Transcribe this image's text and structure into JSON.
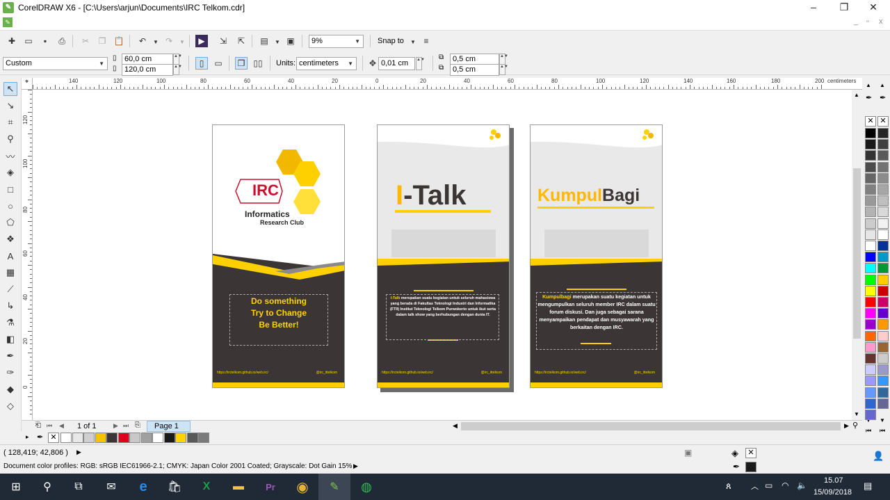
{
  "app": {
    "title": "CorelDRAW X6 - [C:\\Users\\arjun\\Documents\\IRC Telkom.cdr]"
  },
  "window": {
    "minimize": "–",
    "restore": "❐",
    "close": "✕",
    "doc_min": "_",
    "doc_restore": "▫",
    "doc_close": "x"
  },
  "toolbar": {
    "zoom": "9%",
    "snap_to": "Snap to"
  },
  "property_bar": {
    "preset": "Custom",
    "width": "60,0 cm",
    "height": "120,0 cm",
    "units_label": "Units:",
    "units": "centimeters",
    "nudge": "0,01 cm",
    "dup_x": "0,5 cm",
    "dup_y": "0,5 cm"
  },
  "ruler": {
    "h_labels": [
      "140",
      "120",
      "100",
      "80",
      "60",
      "40",
      "20",
      "0",
      "20",
      "40",
      "60",
      "80",
      "100",
      "120",
      "140",
      "160",
      "180",
      "200"
    ],
    "h_unit": "centimeters",
    "v_labels": [
      "120",
      "100",
      "80",
      "60",
      "40",
      "20",
      "0"
    ],
    "v_unit": "centimeters"
  },
  "pages": {
    "page1": {
      "brand": "IRC",
      "club_line1": "Informatics",
      "club_line2": "Research Club",
      "slogan1": "Do something",
      "slogan2": "Try to Change",
      "slogan3": "Be Better!",
      "footer_web": "https://irctelkom.github.io/web.irc/",
      "footer_ig": "@irc_ittelkom"
    },
    "page2": {
      "title": "I-Talk",
      "title_accent": "I",
      "title_rest": "-Talk",
      "desc_highlight": "I-Talk",
      "desc": "merupakan suatu kegiatan untuk seluruh mahasiswa yang berada di Fakultas Teknologi Industri dan Informatika (FTII) Institut Teknologi Telkom Purwokerto untuk ikut serta dalam talk show yang berhubungan dengan dunia IT.",
      "footer_web": "https://irctelkom.github.io/web.irc/",
      "footer_ig": "@irc_ittelkom"
    },
    "page3": {
      "title_accent": "Kumpul",
      "title_rest": "Bagi",
      "desc_highlight": "Kumpulbagi",
      "desc": "merupakan suatu kegiatan untuk mengumpulkan seluruh member IRC dalam suatu forum diskusi. Dan juga sebagai sarana menyampaikan pendapat dan musyawarah yang berkaitan dengan IRC.",
      "footer_web": "https://irctelkom.github.io/web.irc/",
      "footer_ig": "@irc_ittelkom"
    }
  },
  "pagebar": {
    "counter": "1 of 1",
    "tab": "Page 1"
  },
  "status": {
    "coords": "( 128,419; 42,806 )",
    "profiles": "Document color profiles: RGB: sRGB IEC61966-2.1; CMYK: Japan Color 2001 Coated; Grayscale: Dot Gain 15%"
  },
  "palette_colors": [
    "#000000",
    "#1a1a1a",
    "#333333",
    "#4d4d4d",
    "#666666",
    "#808080",
    "#999999",
    "#b3b3b3",
    "#cccccc",
    "#e6e6e6",
    "#ffffff",
    "#0000ff",
    "#00ffff",
    "#00ff00",
    "#ffff00",
    "#ff0000",
    "#ff00ff",
    "#9900cc",
    "#ff6600",
    "#ff99cc",
    "#663333",
    "#ccccff",
    "#9999ff",
    "#6699ff",
    "#3366cc",
    "#6666cc"
  ],
  "palette_colors2": [
    "#262626",
    "#404040",
    "#595959",
    "#737373",
    "#8c8c8c",
    "#a6a6a6",
    "#bfbfbf",
    "#d9d9d9",
    "#f2f2f2",
    "#ffffff",
    "#003399",
    "#0099cc",
    "#009933",
    "#ffcc00",
    "#cc0000",
    "#cc0066",
    "#6600cc",
    "#ff9900",
    "#ffcccc",
    "#996633",
    "#cccccc",
    "#9999cc",
    "#3399ff",
    "#336699",
    "#666699"
  ],
  "doc_palette": [
    "#ffffff",
    "#e8e8e8",
    "#cfcfcf",
    "#f5c400",
    "#3b3635",
    "#e0001b",
    "#c8c8c8",
    "#a0a0a0",
    "#ffffff",
    "#1a1a1a",
    "#ffd400",
    "#595959",
    "#7a7a7a"
  ],
  "taskbar": {
    "time": "15.07",
    "date": "15/09/2018"
  }
}
